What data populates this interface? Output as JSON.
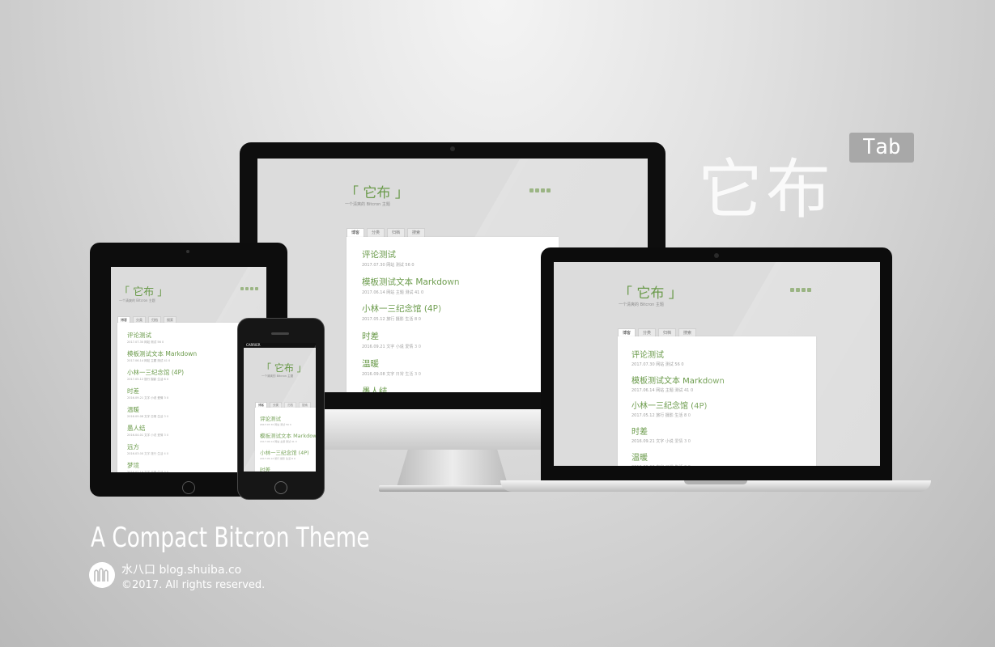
{
  "hero": {
    "title": "它布",
    "badge": "Tab"
  },
  "tagline": "A Compact Bitcron Theme",
  "author": {
    "name": "水八口 blog.shuiba.co",
    "copyright": "©2017. All rights reserved."
  },
  "blog": {
    "title": "「 它布 」",
    "subtitle": "一个清爽的 Bitcron 主题",
    "tabs": [
      "博客",
      "分类",
      "归档",
      "搜索"
    ],
    "posts": [
      {
        "title": "评论测试",
        "meta": "2017.07.30  网站  测试  56  0"
      },
      {
        "title": "模板测试文本 Markdown",
        "meta": "2017.06.14  网站  主题 测试  41  0"
      },
      {
        "title": "小林一三纪念馆 (4P)",
        "meta": "2017.05.12  旅行  摄影 生活  8  0"
      },
      {
        "title": "时差",
        "meta": "2016.09.21  文字  小说 爱情  3  0"
      },
      {
        "title": "温暖",
        "meta": "2016.09.08  文字  日常 生活  3  0"
      },
      {
        "title": "愚人结",
        "meta": "2016.04.01  文字  小说 爱情  3  0"
      },
      {
        "title": "远方",
        "meta": "2016.03.08  文字  旅行 生活  4  0"
      },
      {
        "title": "梦境",
        "meta": "2016.02.19  文字  日常 生活  3  0"
      }
    ],
    "phone_status": "CARRIER"
  },
  "colors": {
    "accent": "#6a9a4a",
    "meta": "#a0a0a0"
  }
}
